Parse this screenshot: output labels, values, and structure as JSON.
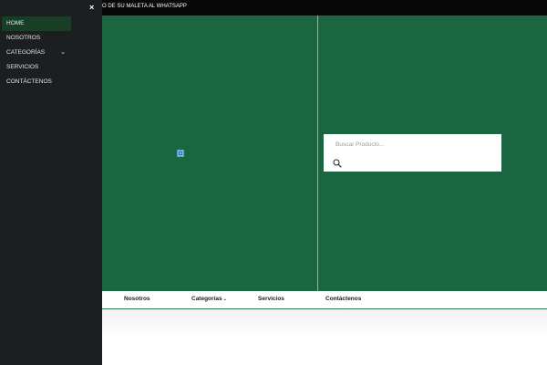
{
  "top_bar": {
    "text": "O DE SU MALETA AL WHATSAPP"
  },
  "side_menu": {
    "close_symbol": "×",
    "items": [
      {
        "label": "HOME",
        "active": true
      },
      {
        "label": "NOSOTROS"
      },
      {
        "label": "CATEGORÍAS",
        "icon": "chevron-down-icon"
      },
      {
        "label": "SERVICIOS"
      },
      {
        "label": "CONTÁCTENOS"
      }
    ]
  },
  "search": {
    "placeholder": "Buscar Producto...",
    "icon": "search-icon"
  },
  "nav": {
    "items": [
      {
        "label": "Nosotros"
      },
      {
        "label": "Categorías",
        "caret": "⌄"
      },
      {
        "label": "Servicios"
      },
      {
        "label": "Contáctenos"
      }
    ]
  },
  "colors": {
    "sidebar": "#1c1e20",
    "hero_green": "#1a6640",
    "active_item": "#173f26",
    "topbar": "#080808"
  }
}
